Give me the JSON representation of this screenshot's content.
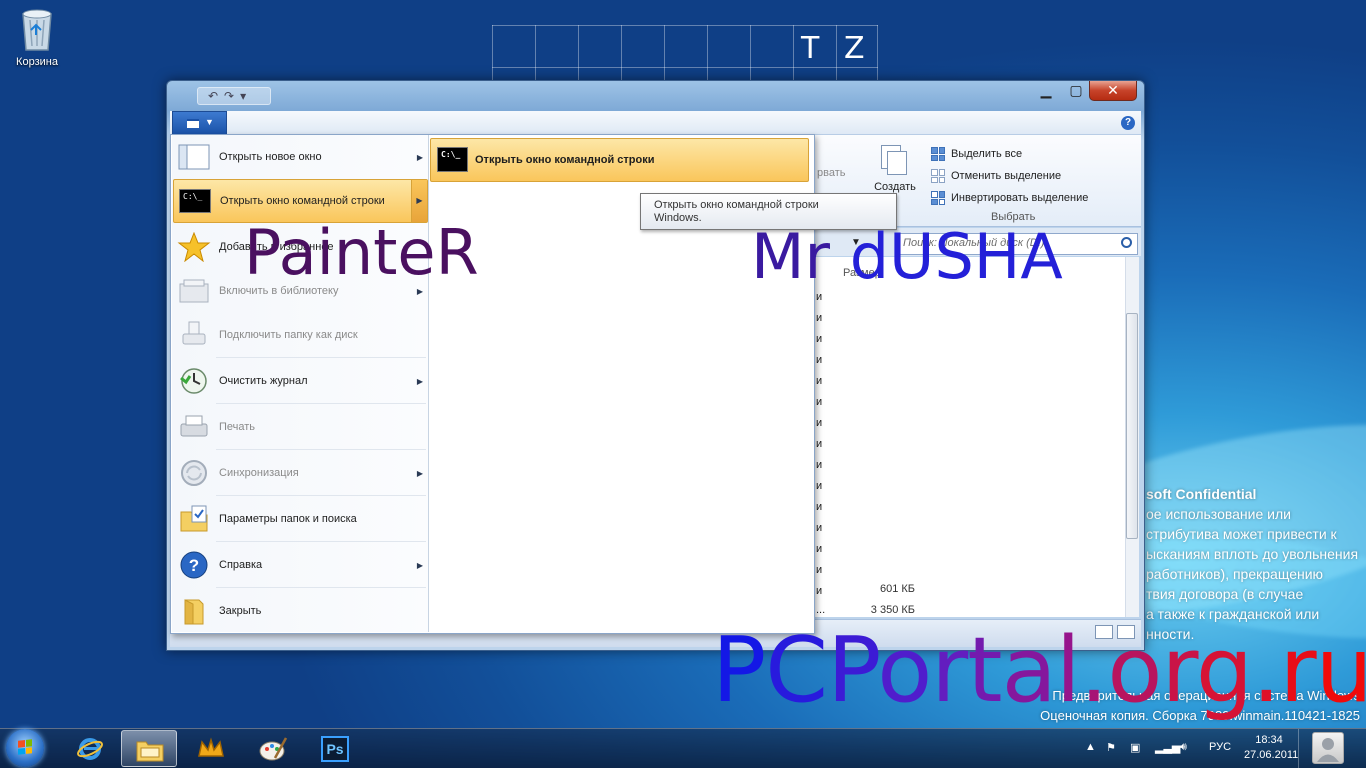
{
  "desktop": {
    "recycle_bin_label": "Корзина",
    "grid_letters": [
      "T",
      "Z"
    ],
    "watermark": {
      "title": "soft Confidential",
      "lines": [
        "ое использование или",
        "стрибутива может привести к",
        "ысканиям вплоть до увольнения",
        "работников), прекращению",
        "твия договора (в случае",
        "а также к гражданской или",
        "нности."
      ],
      "bottom_line1": "Предварительная операционная система Windows",
      "bottom_line2": "Оценочная копия. Сборка 7989.winmain.110421-1825"
    }
  },
  "window": {
    "ribbon": {
      "create_label": "Создать",
      "faded_label": "рвать",
      "select_all": "Выделить все",
      "select_none": "Отменить выделение",
      "invert_selection": "Инвертировать выделение",
      "select_group_label": "Выбрать",
      "help_icon": "question-icon"
    },
    "search_placeholder": "Поиск: Локальный диск (D:)",
    "column_header": "Размер",
    "row_labels": [
      "и",
      "и",
      "и",
      "и",
      "и",
      "и",
      "и",
      "и",
      "и",
      "и",
      "и",
      "и",
      "и",
      "и",
      "и"
    ],
    "sizes": [
      "601 КБ",
      "3 350 КБ"
    ],
    "size_prefix": "..."
  },
  "file_menu": {
    "items": [
      {
        "label": "Открыть новое окно",
        "icon": "window-icon",
        "has_submenu": true,
        "disabled": false
      },
      {
        "label": "Открыть окно командной строки",
        "icon": "cmd-icon",
        "has_submenu": true,
        "disabled": false,
        "active": true
      },
      {
        "label": "Добавить в избранное",
        "icon": "star-icon",
        "has_submenu": false,
        "disabled": false
      },
      {
        "label": "Включить в библиотеку",
        "icon": "library-icon",
        "has_submenu": true,
        "disabled": true
      },
      {
        "label": "Подключить папку как диск",
        "icon": "network-drive-icon",
        "has_submenu": false,
        "disabled": true
      },
      {
        "label": "Очистить журнал",
        "icon": "history-icon",
        "has_submenu": true,
        "disabled": false
      },
      {
        "label": "Печать",
        "icon": "printer-icon",
        "has_submenu": false,
        "disabled": true
      },
      {
        "label": "Синхронизация",
        "icon": "sync-icon",
        "has_submenu": true,
        "disabled": true
      },
      {
        "label": "Параметры папок и поиска",
        "icon": "folder-options-icon",
        "has_submenu": false,
        "disabled": false
      },
      {
        "label": "Справка",
        "icon": "help-icon",
        "has_submenu": true,
        "disabled": false
      },
      {
        "label": "Закрыть",
        "icon": "close-folder-icon",
        "has_submenu": false,
        "disabled": false
      }
    ],
    "submenu_item": "Открыть окно командной строки",
    "tooltip_line1": "Открыть окно командной строки",
    "tooltip_line2": "Windows."
  },
  "overlays": {
    "painter": "PainteR",
    "mr": "Mr ",
    "dusha": "dUSHA",
    "pcportal": "PCPortal.org.ru"
  },
  "taskbar": {
    "apps": [
      "internet-explorer-icon",
      "explorer-folder-icon",
      "crown-app-icon",
      "paint-palette-icon",
      "photoshop-icon"
    ],
    "photoshop_label": "Ps",
    "language": "РУС",
    "time": "18:34",
    "date": "27.06.2011"
  },
  "colors": {
    "menu_highlight": "#fac65b",
    "window_frame": "#7ea9d6",
    "close_button": "#c7432a"
  }
}
